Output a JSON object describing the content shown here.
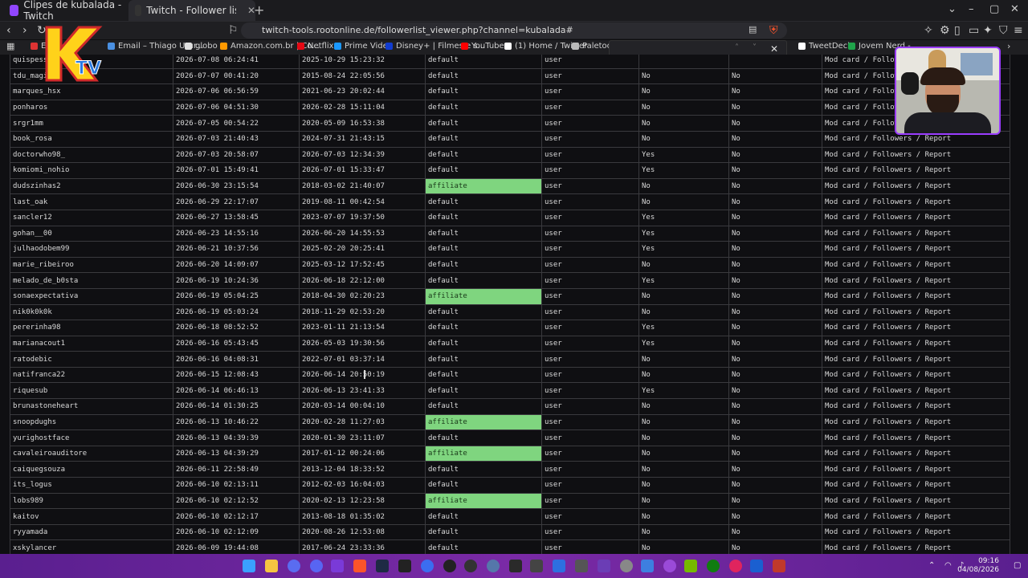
{
  "tabs": [
    {
      "label": "Clipes de kubalada - Twitch"
    },
    {
      "label": "Twitch - Follower list viewer - ku"
    }
  ],
  "address_url": "twitch-tools.rootonline.de/followerlist_viewer.php?channel=kubalada#",
  "bookmarks": [
    {
      "label": "Em",
      "color": "#d33"
    },
    {
      "label": "Email – Thiago Urur...",
      "color": "#4a90e2"
    },
    {
      "label": "globo",
      "color": "#e0e0e0"
    },
    {
      "label": "Amazon.com.br | Co...",
      "color": "#ff9900"
    },
    {
      "label": "Netflix",
      "color": "#e50914"
    },
    {
      "label": "Prime Video",
      "color": "#1a98ff"
    },
    {
      "label": "Disney+ | Filmes e s...",
      "color": "#113ccf"
    },
    {
      "label": "YouTube",
      "color": "#ff0000"
    },
    {
      "label": "(1) Home / Twitter",
      "color": "#ffffff"
    },
    {
      "label": "Paletools",
      "color": "#bbbbbb"
    },
    {
      "label": "TweetDeck",
      "color": "#ffffff"
    },
    {
      "label": "Jovem Nerd -",
      "color": "#1fa34a"
    }
  ],
  "rows": [
    [
      "quispessa",
      "2026-07-08 06:24:41",
      "2025-10-29 15:23:32",
      "default",
      "user",
      "",
      "",
      "Mod card / Followers"
    ],
    [
      "tdu_magic",
      "2026-07-07 00:41:20",
      "2015-08-24 22:05:56",
      "default",
      "user",
      "No",
      "No",
      "Mod card / Followers"
    ],
    [
      "marques_hsx",
      "2026-07-06 06:56:59",
      "2021-06-23 20:02:44",
      "default",
      "user",
      "No",
      "No",
      "Mod card / Followers"
    ],
    [
      "ponharos",
      "2026-07-06 04:51:30",
      "2026-02-28 15:11:04",
      "default",
      "user",
      "No",
      "No",
      "Mod card / Followers"
    ],
    [
      "srgr1mm",
      "2026-07-05 00:54:22",
      "2020-05-09 16:53:38",
      "default",
      "user",
      "No",
      "No",
      "Mod card / Followers"
    ],
    [
      "book_rosa",
      "2026-07-03 21:40:43",
      "2024-07-31 21:43:15",
      "default",
      "user",
      "No",
      "No",
      "Mod card / Followers / Report"
    ],
    [
      "doctorwho98_",
      "2026-07-03 20:58:07",
      "2026-07-03 12:34:39",
      "default",
      "user",
      "Yes",
      "No",
      "Mod card / Followers / Report"
    ],
    [
      "komiomi_nohio",
      "2026-07-01 15:49:41",
      "2026-07-01 15:33:47",
      "default",
      "user",
      "Yes",
      "No",
      "Mod card / Followers / Report"
    ],
    [
      "dudszinhas2",
      "2026-06-30 23:15:54",
      "2018-03-02 21:40:07",
      "affiliate",
      "user",
      "No",
      "No",
      "Mod card / Followers / Report"
    ],
    [
      "last_oak",
      "2026-06-29 22:17:07",
      "2019-08-11 00:42:54",
      "default",
      "user",
      "No",
      "No",
      "Mod card / Followers / Report"
    ],
    [
      "sancler12",
      "2026-06-27 13:58:45",
      "2023-07-07 19:37:50",
      "default",
      "user",
      "Yes",
      "No",
      "Mod card / Followers / Report"
    ],
    [
      "gohan__00",
      "2026-06-23 14:55:16",
      "2026-06-20 14:55:53",
      "default",
      "user",
      "Yes",
      "No",
      "Mod card / Followers / Report"
    ],
    [
      "julhaodobem99",
      "2026-06-21 10:37:56",
      "2025-02-20 20:25:41",
      "default",
      "user",
      "Yes",
      "No",
      "Mod card / Followers / Report"
    ],
    [
      "marie_ribeiroo",
      "2026-06-20 14:09:07",
      "2025-03-12 17:52:45",
      "default",
      "user",
      "No",
      "No",
      "Mod card / Followers / Report"
    ],
    [
      "melado_de_b0sta",
      "2026-06-19 10:24:36",
      "2026-06-18 22:12:00",
      "default",
      "user",
      "Yes",
      "No",
      "Mod card / Followers / Report"
    ],
    [
      "sonaexpectativa",
      "2026-06-19 05:04:25",
      "2018-04-30 02:20:23",
      "affiliate",
      "user",
      "No",
      "No",
      "Mod card / Followers / Report"
    ],
    [
      "nik0k0k0k",
      "2026-06-19 05:03:24",
      "2018-11-29 02:53:20",
      "default",
      "user",
      "No",
      "No",
      "Mod card / Followers / Report"
    ],
    [
      "pererinha98",
      "2026-06-18 08:52:52",
      "2023-01-11 21:13:54",
      "default",
      "user",
      "Yes",
      "No",
      "Mod card / Followers / Report"
    ],
    [
      "marianacout1",
      "2026-06-16 05:43:45",
      "2026-05-03 19:30:56",
      "default",
      "user",
      "Yes",
      "No",
      "Mod card / Followers / Report"
    ],
    [
      "ratodebic",
      "2026-06-16 04:08:31",
      "2022-07-01 03:37:14",
      "default",
      "user",
      "No",
      "No",
      "Mod card / Followers / Report"
    ],
    [
      "natifranca22",
      "2026-06-15 12:08:43",
      "2026-06-14 20:50:19",
      "default",
      "user",
      "No",
      "No",
      "Mod card / Followers / Report"
    ],
    [
      "riquesub",
      "2026-06-14 06:46:13",
      "2026-06-13 23:41:33",
      "default",
      "user",
      "Yes",
      "No",
      "Mod card / Followers / Report"
    ],
    [
      "brunastoneheart",
      "2026-06-14 01:30:25",
      "2020-03-14 00:04:10",
      "default",
      "user",
      "No",
      "No",
      "Mod card / Followers / Report"
    ],
    [
      "snoopdughs",
      "2026-06-13 10:46:22",
      "2020-02-28 11:27:03",
      "affiliate",
      "user",
      "No",
      "No",
      "Mod card / Followers / Report"
    ],
    [
      "yurighostface",
      "2026-06-13 04:39:39",
      "2020-01-30 23:11:07",
      "default",
      "user",
      "No",
      "No",
      "Mod card / Followers / Report"
    ],
    [
      "cavaleiroauditore",
      "2026-06-13 04:39:29",
      "2017-01-12 00:24:06",
      "affiliate",
      "user",
      "No",
      "No",
      "Mod card / Followers / Report"
    ],
    [
      "caiquegsouza",
      "2026-06-11 22:58:49",
      "2013-12-04 18:33:52",
      "default",
      "user",
      "No",
      "No",
      "Mod card / Followers / Report"
    ],
    [
      "its_logus",
      "2026-06-10 02:13:11",
      "2012-02-03 16:04:03",
      "default",
      "user",
      "No",
      "No",
      "Mod card / Followers / Report"
    ],
    [
      "lobs989",
      "2026-06-10 02:12:52",
      "2020-02-13 12:23:58",
      "affiliate",
      "user",
      "No",
      "No",
      "Mod card / Followers / Report"
    ],
    [
      "kaitov",
      "2026-06-10 02:12:17",
      "2013-08-18 01:35:02",
      "default",
      "user",
      "No",
      "No",
      "Mod card / Followers / Report"
    ],
    [
      "ryyamada",
      "2026-06-10 02:12:09",
      "2020-08-26 12:53:08",
      "default",
      "user",
      "No",
      "No",
      "Mod card / Followers / Report"
    ],
    [
      "xskylancer",
      "2026-06-09 19:44:08",
      "2017-06-24 23:33:36",
      "default",
      "user",
      "No",
      "No",
      "Mod card / Followers / Report"
    ]
  ],
  "taskbar": {
    "time": "09:16",
    "date": "04/08/2026"
  },
  "colors": {
    "affiliate_bg": "#7fd57f",
    "webcam_border": "#9a3cff",
    "taskbar": "#6a2599"
  }
}
